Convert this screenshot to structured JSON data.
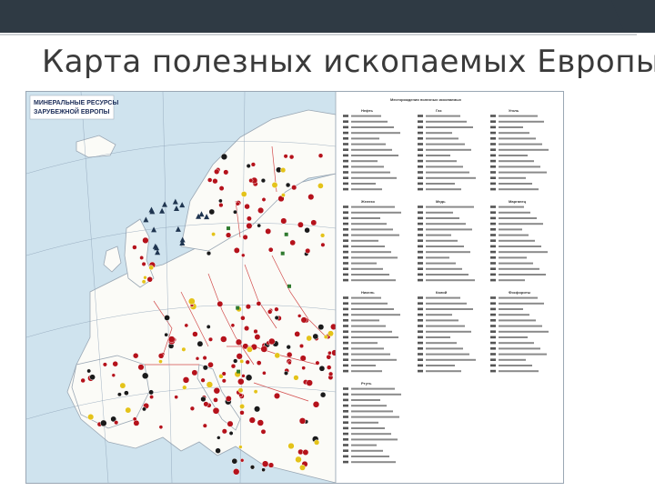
{
  "slide": {
    "title": "Карта полезных ископаемых Европы"
  },
  "map": {
    "heading_line1": "МИНЕРАЛЬНЫЕ РЕСУРСЫ",
    "heading_line2": "ЗАРУБЕЖНОЙ ЕВРОПЫ",
    "legend_title": "Месторождения полезных ископаемых",
    "legend_groups": [
      "Нефть",
      "Газ",
      "Уголь",
      "Железо",
      "Медь",
      "Марганец",
      "Никель",
      "Калий",
      "Фосфориты",
      "Ртуть"
    ],
    "colors": {
      "sea": "#cfe3ee",
      "land": "#fbfbf7",
      "border": "#d24b4b",
      "deposit_red": "#b5121b",
      "deposit_black": "#1a1a1a",
      "deposit_yellow": "#e4c31a",
      "deposit_green": "#2f7a2f"
    }
  }
}
